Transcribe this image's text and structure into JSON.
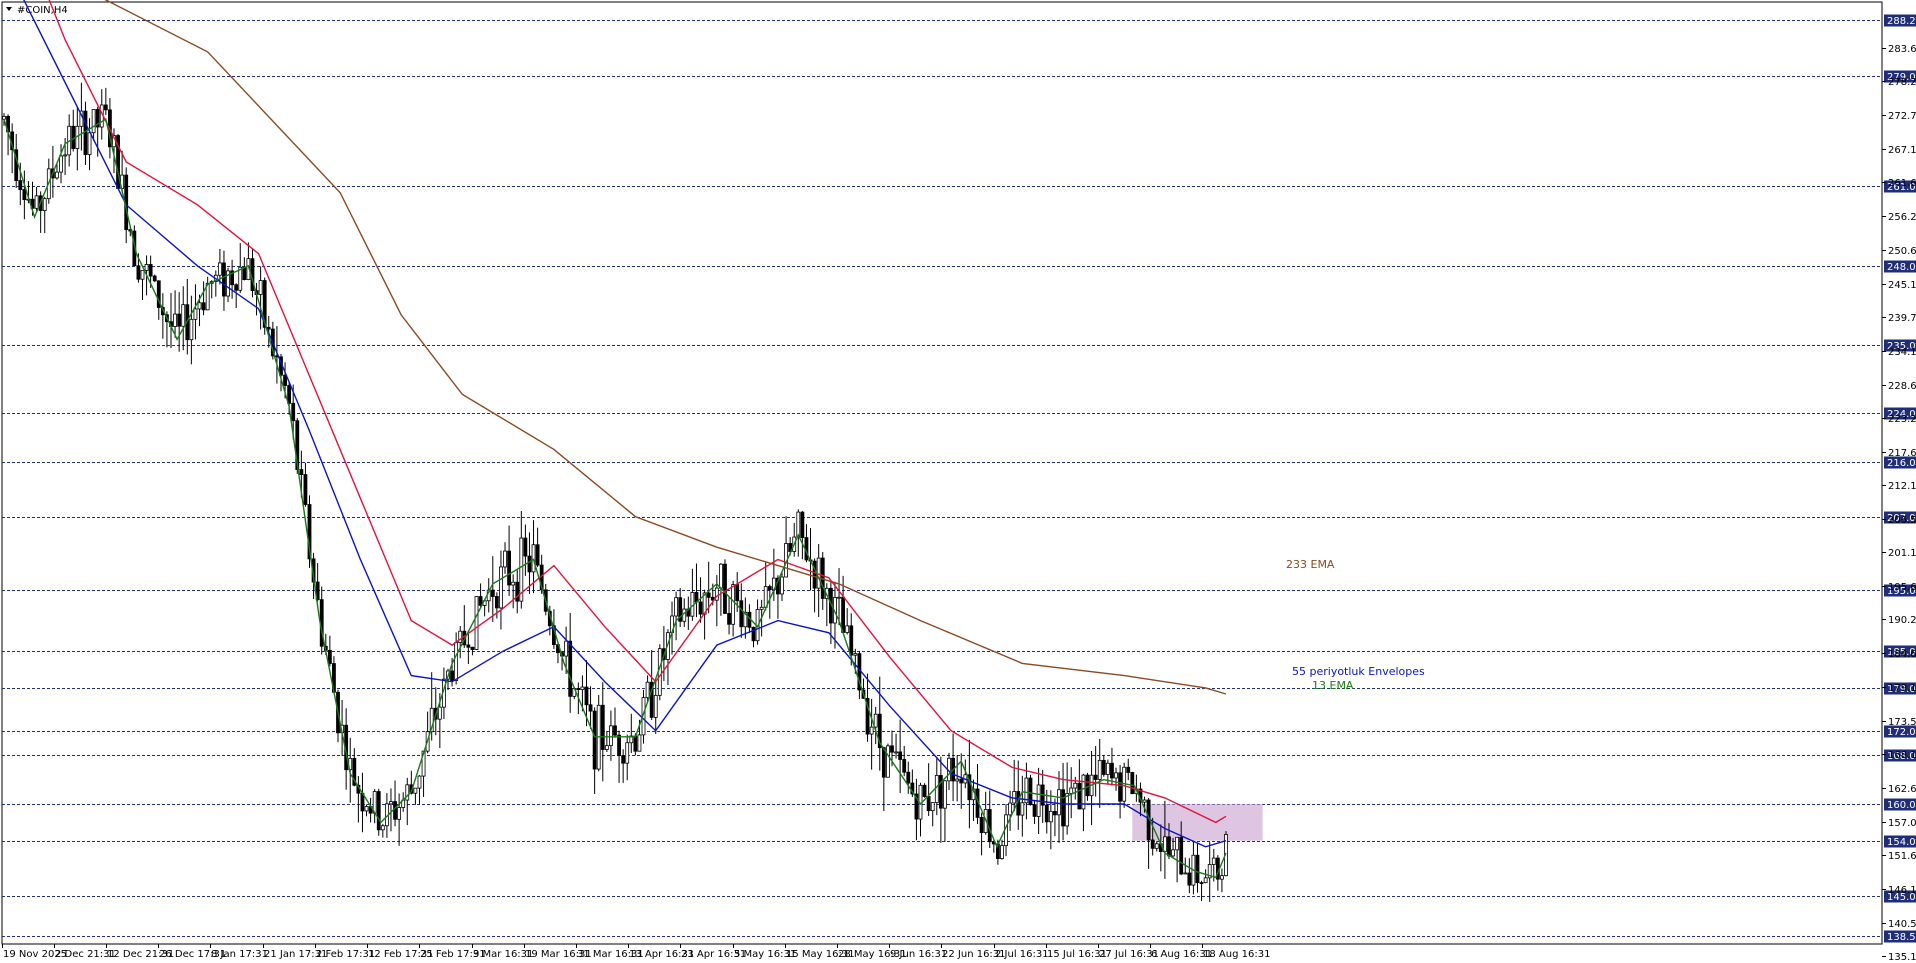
{
  "window": {
    "symbol_title": "#COIN,H4"
  },
  "colors": {
    "background": "#ffffff",
    "grid_level": "#1f2d7a",
    "candle_up": "#ffffff",
    "candle_down": "#000000",
    "ema13": "#1a7a1a",
    "envelope_upper": "#e0143c",
    "envelope_lower": "#0a14c8",
    "ema233": "#8b4a22",
    "level_badge_bg": "#1f2d7a",
    "zone_fill": "#c8a0d0"
  },
  "chart_data": {
    "type": "candlestick",
    "title": "#COIN,H4",
    "ylim": [
      135.15,
      291.0
    ],
    "y_ticks": [
      "283.65",
      "278.20",
      "272.70",
      "267.15",
      "261.65",
      "256.20",
      "250.65",
      "245.10",
      "239.70",
      "234.15",
      "228.60",
      "223.20",
      "217.65",
      "212.10",
      "206.55",
      "201.15",
      "195.60",
      "190.20",
      "184.65",
      "179.10",
      "173.55",
      "168.15",
      "162.60",
      "157.05",
      "151.65",
      "146.10",
      "140.55",
      "135.15"
    ],
    "x_tick_labels": [
      "19 Nov 2025",
      "2 Dec 21:31",
      "12 Dec 21:31",
      "26 Dec 17:31",
      "8 Jan 17:31",
      "21 Jan 17:31",
      "2 Feb 17:31",
      "12 Feb 17:31",
      "25 Feb 17:31",
      "9 Mar 16:31",
      "19 Mar 16:31",
      "31 Mar 16:31",
      "13 Apr 16:31",
      "23 Apr 16:31",
      "5 May 16:31",
      "15 May 16:31",
      "28 May 16:31",
      "9 Jun 16:31",
      "22 Jun 16:31",
      "2 Jul 16:31",
      "15 Jul 16:31",
      "27 Jul 16:31",
      "6 Aug 16:31",
      "18 Aug 16:31"
    ],
    "horizontal_levels": [
      {
        "value": 288.24,
        "label": "288.24"
      },
      {
        "value": 279.0,
        "label": "279.00"
      },
      {
        "value": 261.0,
        "label": "261.00"
      },
      {
        "value": 248.0,
        "label": "248.00"
      },
      {
        "value": 235.0,
        "label": "235.00"
      },
      {
        "value": 224.0,
        "label": "224.00"
      },
      {
        "value": 216.0,
        "label": "216.00"
      },
      {
        "value": 207.0,
        "label": "207.00"
      },
      {
        "value": 195.0,
        "label": "195.00"
      },
      {
        "value": 185.0,
        "label": "185.00"
      },
      {
        "value": 179.0,
        "label": "179.00"
      },
      {
        "value": 172.0,
        "label": "172.00"
      },
      {
        "value": 168.0,
        "label": "168.00"
      },
      {
        "value": 160.0,
        "label": "160.00"
      },
      {
        "value": 154.0,
        "label": "154.00"
      },
      {
        "value": 145.0,
        "label": "145.00"
      },
      {
        "value": 138.5,
        "label": "138.50"
      }
    ],
    "series": [
      {
        "name": "233 EMA",
        "color": "#8b4a22",
        "points": [
          [
            0,
            300
          ],
          [
            200,
            283
          ],
          [
            330,
            260
          ],
          [
            390,
            240
          ],
          [
            450,
            227
          ],
          [
            540,
            218
          ],
          [
            620,
            207
          ],
          [
            700,
            202
          ],
          [
            820,
            196
          ],
          [
            900,
            190
          ],
          [
            1000,
            183
          ],
          [
            1100,
            181
          ],
          [
            1180,
            179
          ],
          [
            1200,
            178
          ]
        ]
      },
      {
        "name": "55 periyotluk Envelopes",
        "color": "#e0143c",
        "points": [
          [
            0,
            310
          ],
          [
            60,
            285
          ],
          [
            120,
            265
          ],
          [
            190,
            258
          ],
          [
            250,
            250
          ],
          [
            300,
            230
          ],
          [
            350,
            210
          ],
          [
            400,
            190
          ],
          [
            440,
            186
          ],
          [
            490,
            192
          ],
          [
            540,
            199
          ],
          [
            590,
            189
          ],
          [
            640,
            180
          ],
          [
            700,
            194
          ],
          [
            760,
            200
          ],
          [
            810,
            197
          ],
          [
            870,
            184
          ],
          [
            930,
            172
          ],
          [
            990,
            166
          ],
          [
            1040,
            164
          ],
          [
            1100,
            163
          ],
          [
            1140,
            161
          ],
          [
            1190,
            157
          ],
          [
            1200,
            158
          ]
        ]
      },
      {
        "name": "55 periyotluk Envelopes lower",
        "color": "#0a14c8",
        "points": [
          [
            0,
            298
          ],
          [
            60,
            278
          ],
          [
            120,
            258
          ],
          [
            190,
            248
          ],
          [
            250,
            241
          ],
          [
            300,
            221
          ],
          [
            350,
            200
          ],
          [
            400,
            181
          ],
          [
            440,
            180
          ],
          [
            490,
            185
          ],
          [
            540,
            189
          ],
          [
            590,
            180
          ],
          [
            640,
            172
          ],
          [
            700,
            186
          ],
          [
            760,
            190
          ],
          [
            810,
            188
          ],
          [
            870,
            176
          ],
          [
            930,
            165
          ],
          [
            990,
            161
          ],
          [
            1040,
            160
          ],
          [
            1100,
            160
          ],
          [
            1140,
            156
          ],
          [
            1180,
            153
          ],
          [
            1200,
            154
          ]
        ]
      },
      {
        "name": "13 EMA",
        "color": "#1a7a1a",
        "points": [
          [
            0,
            272
          ],
          [
            30,
            256
          ],
          [
            60,
            268
          ],
          [
            100,
            272
          ],
          [
            130,
            250
          ],
          [
            170,
            236
          ],
          [
            200,
            245
          ],
          [
            240,
            248
          ],
          [
            280,
            225
          ],
          [
            310,
            190
          ],
          [
            340,
            165
          ],
          [
            370,
            157
          ],
          [
            400,
            162
          ],
          [
            440,
            183
          ],
          [
            480,
            196
          ],
          [
            520,
            200
          ],
          [
            550,
            183
          ],
          [
            580,
            171
          ],
          [
            620,
            171
          ],
          [
            660,
            190
          ],
          [
            700,
            196
          ],
          [
            740,
            189
          ],
          [
            780,
            204
          ],
          [
            820,
            190
          ],
          [
            860,
            170
          ],
          [
            900,
            160
          ],
          [
            940,
            167
          ],
          [
            975,
            153
          ],
          [
            1000,
            162
          ],
          [
            1040,
            161
          ],
          [
            1080,
            164
          ],
          [
            1110,
            163
          ],
          [
            1140,
            152
          ],
          [
            1170,
            149
          ],
          [
            1190,
            148
          ],
          [
            1200,
            152
          ]
        ]
      }
    ],
    "candles_sketch": "approximated OHLC in data units, see candles",
    "candles": [],
    "zone": {
      "from": 154.0,
      "to": 160.0
    },
    "annotations": [
      {
        "text": "233 EMA",
        "color": "#8b4a22"
      },
      {
        "text": "55 periyotluk Envelopes",
        "color": "#0a14c8"
      },
      {
        "text": "13 EMA",
        "color": "#1a7a1a"
      }
    ]
  }
}
